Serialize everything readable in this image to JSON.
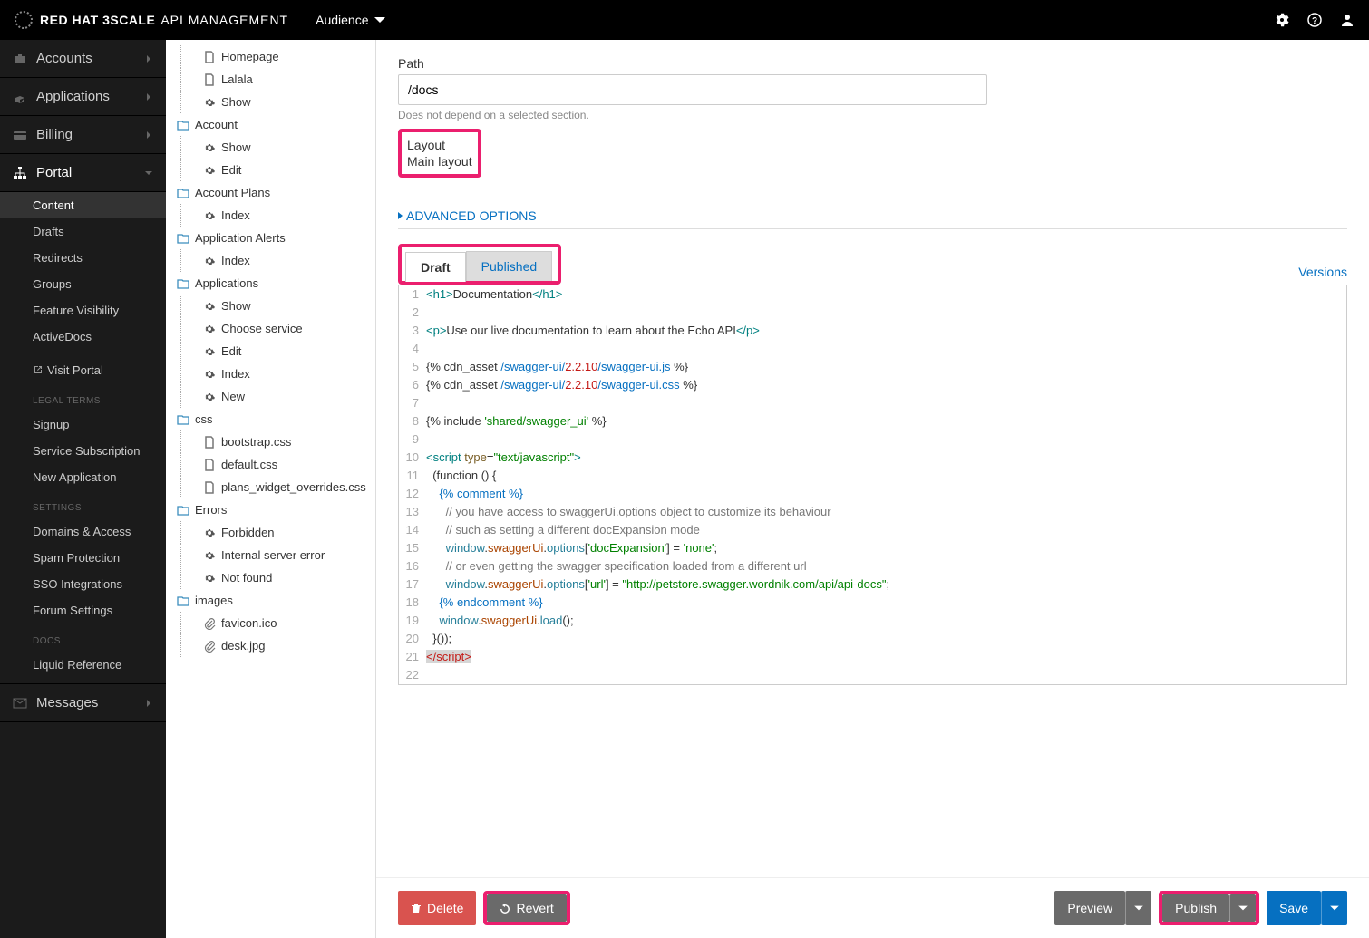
{
  "brand": {
    "name_a": "RED HAT",
    "name_b": "3SCALE",
    "sub": "API MANAGEMENT"
  },
  "audience": "Audience",
  "sidebar": {
    "accounts": "Accounts",
    "applications": "Applications",
    "billing": "Billing",
    "portal": "Portal",
    "portal_items": [
      "Content",
      "Drafts",
      "Redirects",
      "Groups",
      "Feature Visibility",
      "ActiveDocs"
    ],
    "visit": "Visit Portal",
    "legal_head": "Legal Terms",
    "legal": [
      "Signup",
      "Service Subscription",
      "New Application"
    ],
    "settings_head": "Settings",
    "settings": [
      "Domains & Access",
      "Spam Protection",
      "SSO Integrations",
      "Forum Settings"
    ],
    "docs_head": "Docs",
    "docs": [
      "Liquid Reference"
    ],
    "messages": "Messages"
  },
  "tree": [
    {
      "t": "file",
      "l": 1,
      "txt": "Homepage"
    },
    {
      "t": "file",
      "l": 1,
      "txt": "Lalala"
    },
    {
      "t": "cog",
      "l": 1,
      "txt": "Show"
    },
    {
      "t": "folder",
      "l": 0,
      "txt": "Account"
    },
    {
      "t": "cog",
      "l": 1,
      "txt": "Show"
    },
    {
      "t": "cog",
      "l": 1,
      "txt": "Edit"
    },
    {
      "t": "folder",
      "l": 0,
      "txt": "Account Plans"
    },
    {
      "t": "cog",
      "l": 1,
      "txt": "Index"
    },
    {
      "t": "folder",
      "l": 0,
      "txt": "Application Alerts"
    },
    {
      "t": "cog",
      "l": 1,
      "txt": "Index"
    },
    {
      "t": "folder",
      "l": 0,
      "txt": "Applications"
    },
    {
      "t": "cog",
      "l": 1,
      "txt": "Show"
    },
    {
      "t": "cog",
      "l": 1,
      "txt": "Choose service"
    },
    {
      "t": "cog",
      "l": 1,
      "txt": "Edit"
    },
    {
      "t": "cog",
      "l": 1,
      "txt": "Index"
    },
    {
      "t": "cog",
      "l": 1,
      "txt": "New"
    },
    {
      "t": "folder",
      "l": 0,
      "txt": "css"
    },
    {
      "t": "file",
      "l": 1,
      "txt": "bootstrap.css"
    },
    {
      "t": "file",
      "l": 1,
      "txt": "default.css"
    },
    {
      "t": "file",
      "l": 1,
      "txt": "plans_widget_overrides.css"
    },
    {
      "t": "folder",
      "l": 0,
      "txt": "Errors"
    },
    {
      "t": "cog",
      "l": 1,
      "txt": "Forbidden"
    },
    {
      "t": "cog",
      "l": 1,
      "txt": "Internal server error"
    },
    {
      "t": "cog",
      "l": 1,
      "txt": "Not found"
    },
    {
      "t": "folder",
      "l": 0,
      "txt": "images"
    },
    {
      "t": "attach",
      "l": 1,
      "txt": "favicon.ico"
    },
    {
      "t": "attach",
      "l": 1,
      "txt": "desk.jpg"
    }
  ],
  "form": {
    "path_label": "Path",
    "path_value": "/docs",
    "path_hint": "Does not depend on a selected section.",
    "layout_label": "Layout",
    "layout_value": "Main layout",
    "advanced": "ADVANCED OPTIONS",
    "tab_draft": "Draft",
    "tab_published": "Published",
    "versions": "Versions"
  },
  "code": {
    "l1a": "<h1>",
    "l1b": "Documentation",
    "l1c": "</h1>",
    "l3a": "<p>",
    "l3b": "Use our live documentation to learn about the Echo API",
    "l3c": "</p>",
    "l5a": "{% cdn_asset ",
    "l5b": "/swagger-ui/",
    "l5c": "2.2.10",
    "l5d": "/swagger-ui.js",
    "l5e": " %}",
    "l6a": "{% cdn_asset ",
    "l6b": "/swagger-ui/",
    "l6c": "2.2.10",
    "l6d": "/swagger-ui.css",
    "l6e": " %}",
    "l8a": "{% include ",
    "l8b": "'shared/swagger_ui'",
    "l8c": " %}",
    "l10a": "<script ",
    "l10b": "type",
    "l10c": "=",
    "l10d": "\"text/javascript\"",
    "l10e": ">",
    "l11": "  (function () {",
    "l12a": "    ",
    "l12b": "{% comment %}",
    "l13": "      // you have access to swaggerUi.options object to customize its behaviour",
    "l14": "      // such as setting a different docExpansion mode",
    "l15a": "      ",
    "l15b": "window",
    "l15c": ".",
    "l15d": "swaggerUi",
    "l15e": ".",
    "l15f": "options",
    "l15g": "[",
    "l15h": "'docExpansion'",
    "l15i": "] = ",
    "l15j": "'none'",
    "l15k": ";",
    "l16": "      // or even getting the swagger specification loaded from a different url",
    "l17a": "      ",
    "l17b": "window",
    "l17c": ".",
    "l17d": "swaggerUi",
    "l17e": ".",
    "l17f": "options",
    "l17g": "[",
    "l17h": "'url'",
    "l17i": "] = ",
    "l17j": "\"http://petstore.swagger.wordnik.com/api/api-docs\"",
    "l17k": ";",
    "l18a": "    ",
    "l18b": "{% endcomment %}",
    "l19a": "    ",
    "l19b": "window",
    "l19c": ".",
    "l19d": "swaggerUi",
    "l19e": ".",
    "l19f": "load",
    "l19g": "();",
    "l20": "  }());",
    "l21": "</script>"
  },
  "buttons": {
    "delete": "Delete",
    "revert": "Revert",
    "preview": "Preview",
    "publish": "Publish",
    "save": "Save"
  }
}
